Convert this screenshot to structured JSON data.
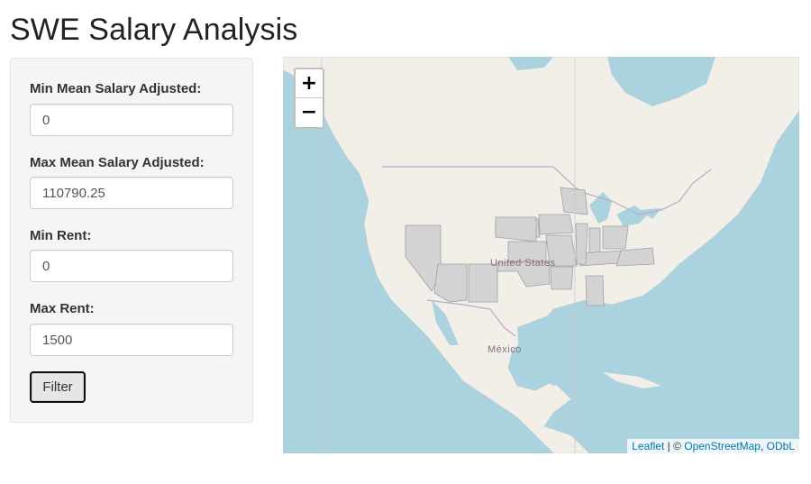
{
  "page": {
    "title": "SWE Salary Analysis"
  },
  "sidebar": {
    "fields": [
      {
        "label": "Min Mean Salary Adjusted:",
        "value": "0"
      },
      {
        "label": "Max Mean Salary Adjusted:",
        "value": "110790.25"
      },
      {
        "label": "Min Rent:",
        "value": "0"
      },
      {
        "label": "Max Rent:",
        "value": "1500"
      }
    ],
    "filter_label": "Filter"
  },
  "map": {
    "zoom_in_label": "+",
    "zoom_out_label": "−",
    "labels": {
      "country_us": "United States",
      "country_mx": "México"
    },
    "attribution": {
      "leaflet": "Leaflet",
      "separator": " | © ",
      "osm": "OpenStreetMap",
      "comma": ", ",
      "odbl": "ODbL"
    },
    "colors": {
      "water": "#aad3df",
      "land": "#f2efe9",
      "highlight": "#d3d3d3",
      "border": "#9a9aaa"
    }
  }
}
